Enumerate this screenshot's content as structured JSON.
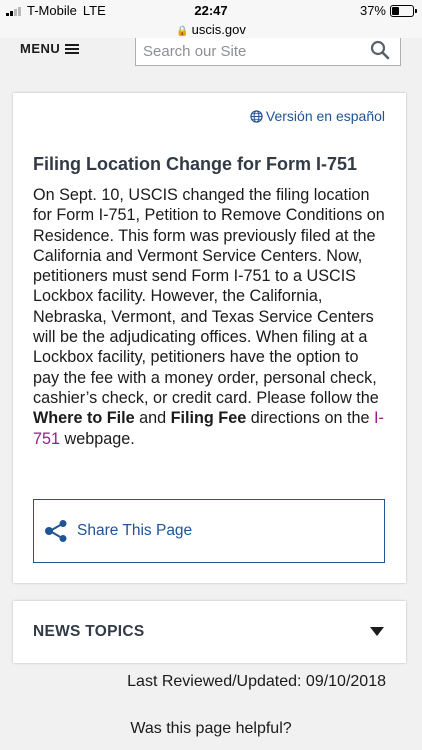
{
  "status_bar": {
    "carrier": "T-Mobile",
    "network": "LTE",
    "time": "22:47",
    "battery": "37%",
    "battery_level": 0.37
  },
  "browser": {
    "url": "uscis.gov"
  },
  "header": {
    "menu_label": "MENU",
    "search_placeholder": "Search our Site"
  },
  "article": {
    "language_link": "Versión en español",
    "title": "Filing Location Change for Form I-751",
    "body_part1": "On Sept. 10, USCIS changed the filing location for Form I-751, Petition to Remove Conditions on Residence. This form was previously filed at the California and Vermont Service Centers. Now, petitioners must send Form I-751 to a USCIS Lockbox facility. However, the California, Nebraska, Vermont, and Texas Service Centers will be the adjudicating offices. When filing at a Lockbox facility, petitioners have the option to pay the fee with a money order, personal check, cashier’s check, or credit card. Please follow the ",
    "where_to_file": "Where to File",
    "and": " and ",
    "filing_fee": "Filing Fee",
    "directions": " directions on the ",
    "link_text": "I-751",
    "webpage": " webpage.",
    "share_label": "Share This Page"
  },
  "news_topics": {
    "label": "NEWS TOPICS"
  },
  "footer": {
    "last_reviewed": "Last Reviewed/Updated: 09/10/2018",
    "helpful_question": "Was this page helpful?"
  },
  "colors": {
    "link_blue": "#205493",
    "visited_link": "#981b88",
    "heading": "#323a45"
  }
}
